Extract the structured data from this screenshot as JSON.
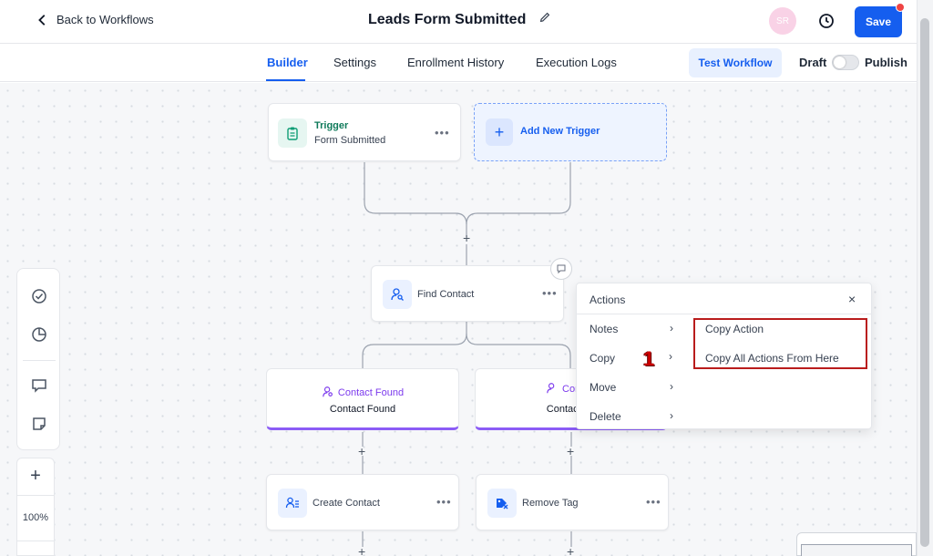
{
  "header": {
    "back_label": "Back to Workflows",
    "title": "Leads Form Submitted",
    "avatar_initials": "SR",
    "save_label": "Save"
  },
  "tabs": [
    {
      "label": "Builder",
      "active": true
    },
    {
      "label": "Settings",
      "active": false
    },
    {
      "label": "Enrollment History",
      "active": false
    },
    {
      "label": "Execution Logs",
      "active": false
    }
  ],
  "toolbar_right": {
    "test_label": "Test Workflow",
    "draft_label": "Draft",
    "publish_label": "Publish",
    "published": false
  },
  "nodes": {
    "trigger": {
      "title": "Trigger",
      "subtitle": "Form Submitted",
      "more": "•••"
    },
    "add_trigger": {
      "plus": "+",
      "label": "Add New Trigger"
    },
    "find_contact": {
      "label": "Find Contact",
      "more": "•••"
    },
    "branch_found": {
      "title": "Contact Found",
      "subtitle": "Contact Found"
    },
    "branch_not_found": {
      "title": "Contact",
      "subtitle": "Contact Nc"
    },
    "create_contact": {
      "label": "Create Contact",
      "more": "•••"
    },
    "remove_tag": {
      "label": "Remove Tag",
      "more": "•••"
    }
  },
  "add_step_symbol": "+",
  "left_toolbar": {
    "icons": [
      "check-circle-icon",
      "pie-chart-icon",
      "comment-icon",
      "sticky-note-icon"
    ],
    "zoom_in": "+",
    "zoom_level": "100%"
  },
  "context_menu": {
    "title": "Actions",
    "close": "×",
    "items": [
      {
        "label": "Notes",
        "chevron": "›"
      },
      {
        "label": "Copy",
        "chevron": "›"
      },
      {
        "label": "Move",
        "chevron": "›"
      },
      {
        "label": "Delete",
        "chevron": "›"
      }
    ],
    "submenu": [
      {
        "label": "Copy Action"
      },
      {
        "label": "Copy All Actions From Here"
      }
    ]
  },
  "annotation": {
    "number": "1",
    "color": "#cc0000"
  },
  "colors": {
    "primary": "#155eef",
    "branch_accent": "#8b5cf6",
    "trigger_icon_bg": "#e6f6f1",
    "highlight_border": "#b91c1c"
  }
}
